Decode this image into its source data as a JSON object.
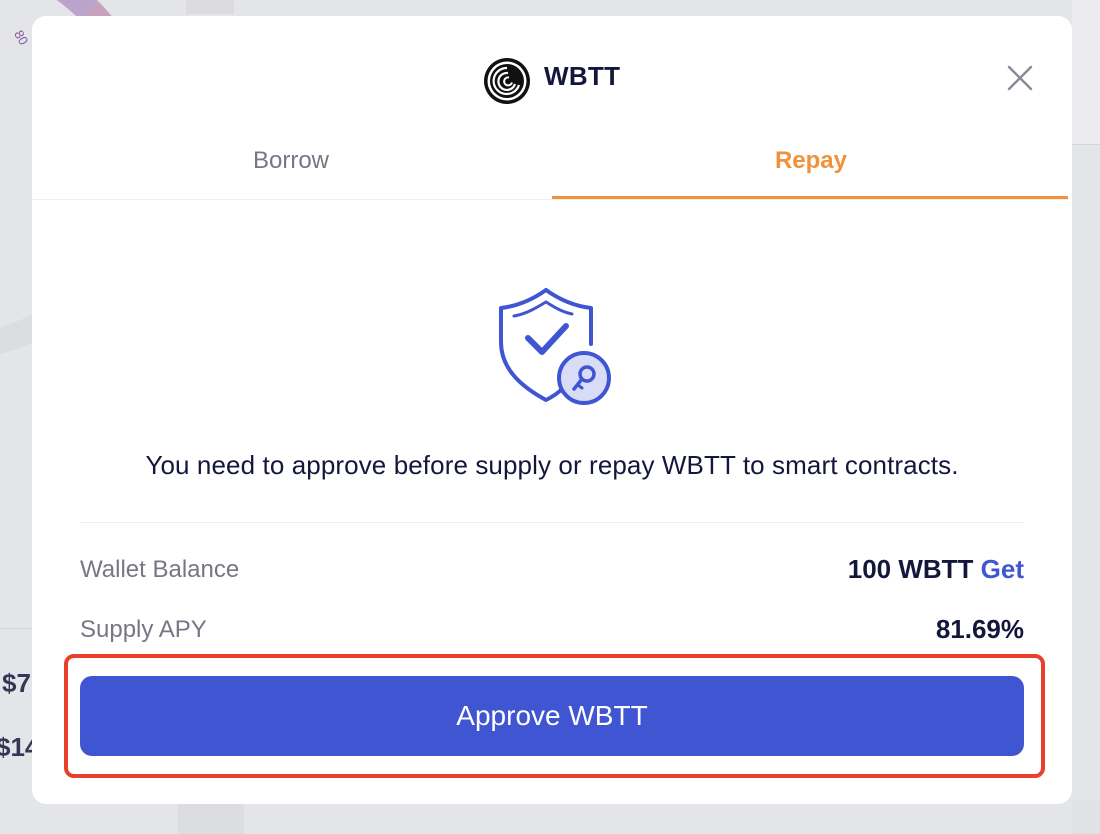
{
  "modal": {
    "token_name": "WBTT",
    "tabs": [
      {
        "label": "Borrow",
        "active": false
      },
      {
        "label": "Repay",
        "active": true
      }
    ],
    "notice": "You need to approve before supply or repay WBTT to smart contracts.",
    "rows": [
      {
        "label": "Wallet Balance",
        "value": "100 WBTT",
        "link": "Get"
      },
      {
        "label": "Supply APY",
        "value": "81.69%"
      }
    ],
    "approve_button": "Approve WBTT"
  },
  "background": {
    "value_1": "$7",
    "value_2": "$14",
    "tiny_label": "80"
  },
  "colors": {
    "accent": "#f0923a",
    "primary": "#4055d2",
    "text_dark": "#14173c",
    "text_muted": "#767785",
    "highlight": "#e9402b"
  },
  "icons": {
    "logo": "bittorrent-logo-icon",
    "close": "close-icon",
    "shield": "shield-check-key-icon"
  }
}
